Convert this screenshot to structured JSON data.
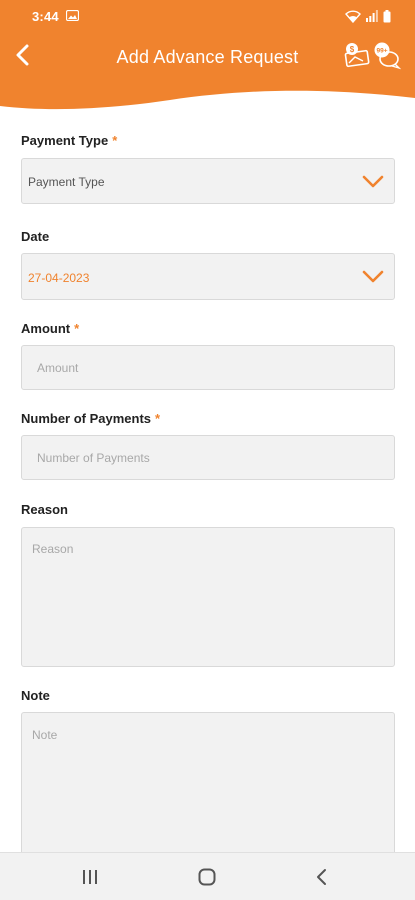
{
  "status_bar": {
    "time": "3:44",
    "icons": [
      "image-icon",
      "wifi-icon",
      "signal-icon",
      "battery-icon"
    ]
  },
  "header": {
    "title": "Add Advance Request",
    "back_icon": "back-arrow-icon",
    "action_icons": [
      "cash-icon",
      "chat-icon"
    ],
    "chat_badge": "99+",
    "cash_badge": "$"
  },
  "form": {
    "payment_type": {
      "label": "Payment Type",
      "required_mark": "*",
      "placeholder": "Payment Type"
    },
    "date": {
      "label": "Date",
      "value": "27-04-2023"
    },
    "amount": {
      "label": "Amount",
      "required_mark": "*",
      "placeholder": "Amount"
    },
    "number_of_payments": {
      "label": "Number of Payments",
      "required_mark": "*",
      "placeholder": "Number of Payments"
    },
    "reason": {
      "label": "Reason",
      "placeholder": "Reason"
    },
    "note": {
      "label": "Note",
      "placeholder": "Note"
    }
  },
  "nav_bar": {
    "icons": [
      "recent-apps-icon",
      "home-icon",
      "back-icon"
    ]
  },
  "colors": {
    "accent": "#f0832e",
    "field_bg": "#f2f2f2",
    "field_border": "#d9d9d9"
  }
}
